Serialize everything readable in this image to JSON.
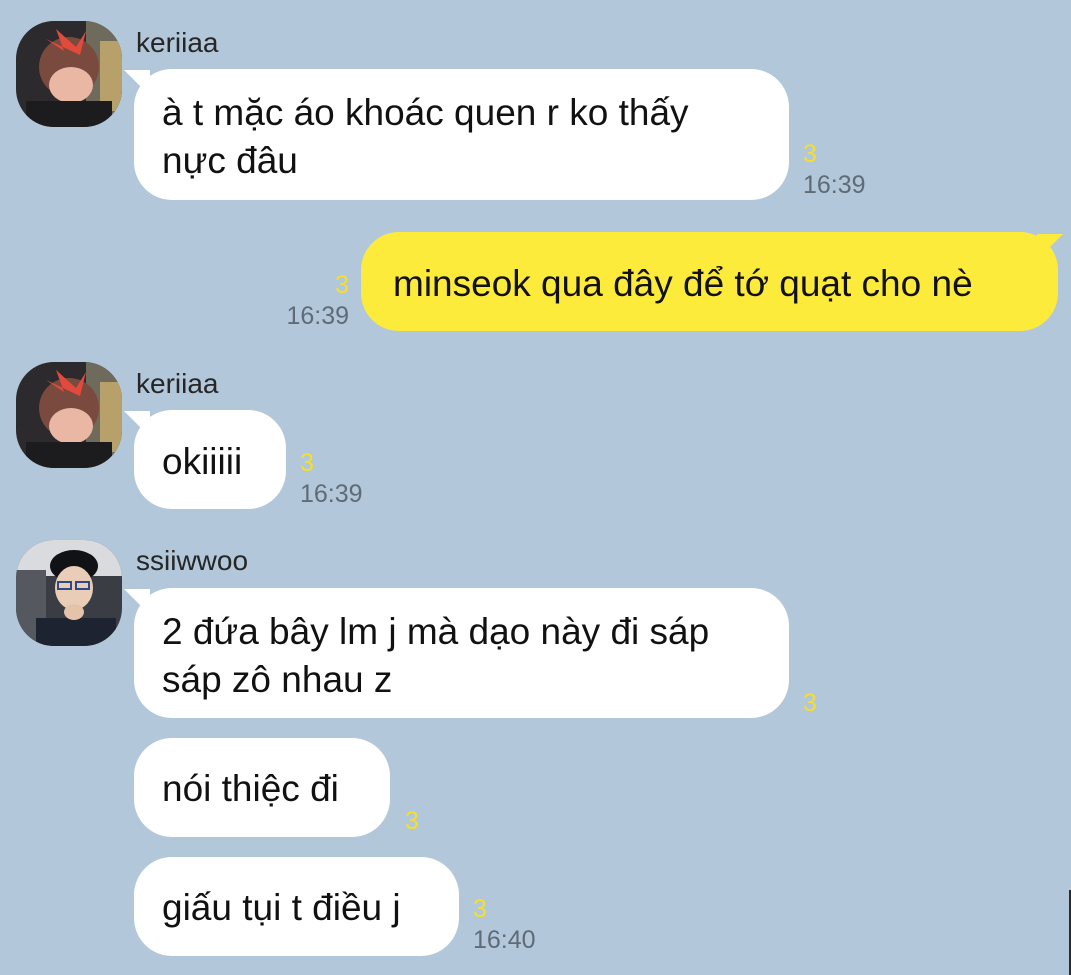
{
  "senders": {
    "keriiaa": "keriiaa",
    "ssiiwwoo": "ssiiwwoo"
  },
  "messages": [
    {
      "sender": "keriiaa",
      "text": "à t mặc áo khoác quen r ko thấy\nnực đâu",
      "unread": "3",
      "time": "16:39"
    },
    {
      "sender": "me",
      "text": "minseok qua đây để tớ quạt cho nè",
      "unread": "3",
      "time": "16:39"
    },
    {
      "sender": "keriiaa",
      "text": "okiiiii",
      "unread": "3",
      "time": "16:39"
    },
    {
      "sender": "ssiiwwoo",
      "text": "2 đứa bây lm j mà dạo này đi sáp\nsáp zô nhau z",
      "unread": "3",
      "time": ""
    },
    {
      "sender": "ssiiwwoo",
      "text": "nói thiệc đi",
      "unread": "3",
      "time": ""
    },
    {
      "sender": "ssiiwwoo",
      "text": "giấu tụi t điều j",
      "unread": "3",
      "time": "16:40"
    }
  ],
  "colors": {
    "background": "#b2c7da",
    "my_bubble": "#fdeb3b",
    "other_bubble": "#ffffff",
    "unread_count": "#f5df2a",
    "timestamp": "#5f6b76"
  }
}
